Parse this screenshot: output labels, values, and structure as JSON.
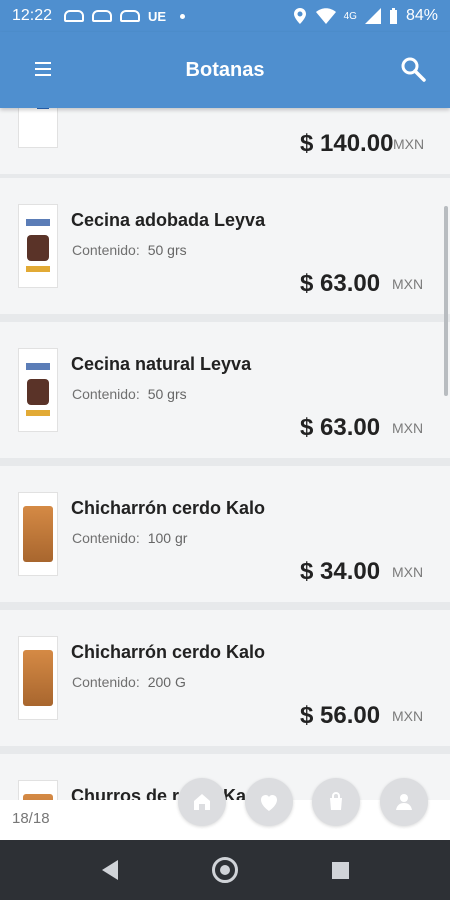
{
  "status_bar": {
    "time": "12:22",
    "notification_label": "UE",
    "battery": "84%",
    "network": "4G"
  },
  "app_bar": {
    "title": "Botanas"
  },
  "list": {
    "content_label": "Contenido:",
    "items": [
      {
        "name": "",
        "content": "",
        "price": "$ 140.00",
        "currency": "MXN",
        "thumb": "device"
      },
      {
        "name": "Cecina adobada Leyva",
        "content": "50 grs",
        "price": "$ 63.00",
        "currency": "MXN",
        "thumb": "jerky"
      },
      {
        "name": "Cecina natural Leyva",
        "content": "50 grs",
        "price": "$ 63.00",
        "currency": "MXN",
        "thumb": "jerky"
      },
      {
        "name": "Chicharrón cerdo Kalo",
        "content": "100 gr",
        "price": "$ 34.00",
        "currency": "MXN",
        "thumb": "bag"
      },
      {
        "name": "Chicharrón cerdo Kalo",
        "content": "200 G",
        "price": "$ 56.00",
        "currency": "MXN",
        "thumb": "bag"
      },
      {
        "name": "Churros de r",
        "tail": "Ka",
        "content": "",
        "price": "",
        "currency": "",
        "thumb": "bag"
      }
    ]
  },
  "bottom": {
    "count": "18/18"
  },
  "icons": {
    "menu": "menu-icon",
    "search": "search-icon",
    "home": "home-icon",
    "heart": "heart-icon",
    "bag": "shopping-bag-icon",
    "user": "user-icon"
  },
  "colors": {
    "primary": "#4f8fcf",
    "background": "#e7e9eb",
    "card": "#f4f5f6",
    "navigation": "#2d3035"
  }
}
